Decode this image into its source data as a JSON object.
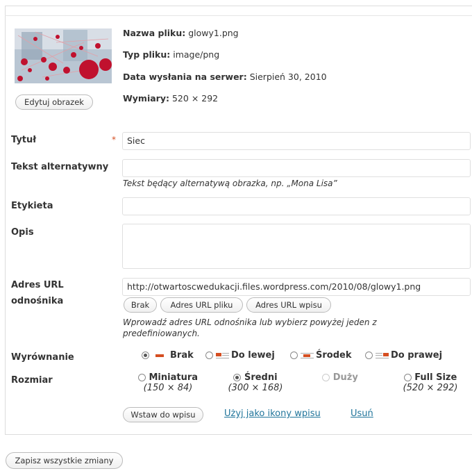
{
  "file": {
    "name_label": "Nazwa pliku:",
    "name": "glowy1.png",
    "type_label": "Typ pliku:",
    "type": "image/png",
    "date_label": "Data wysłania na serwer:",
    "date": "Sierpień 30, 2010",
    "dims_label": "Wymiary:",
    "dims": "520 × 292"
  },
  "edit_image_label": "Edytuj obrazek",
  "fields": {
    "title_label": "Tytuł",
    "title_required": "*",
    "title_value": "Siec",
    "alt_label": "Tekst alternatywny",
    "alt_value": "",
    "alt_hint": "Tekst będący alternatywą obrazka, np. „Mona Lisa”",
    "caption_label": "Etykieta",
    "caption_value": "",
    "desc_label": "Opis",
    "desc_value": "",
    "url_label_1": "Adres URL",
    "url_label_2": "odnośnika",
    "url_value": "http://otwartoscwedukacji.files.wordpress.com/2010/08/glowy1.png",
    "url_buttons": [
      "Brak",
      "Adres URL pliku",
      "Adres URL wpisu"
    ],
    "url_hint_1": "Wprowadź adres URL odnośnika lub wybierz powyżej jeden z",
    "url_hint_2": "predefiniowanych."
  },
  "alignment": {
    "label": "Wyrównanie",
    "options": [
      "Brak",
      "Do lewej",
      "Środek",
      "Do prawej"
    ],
    "selected": "Brak"
  },
  "size": {
    "label": "Rozmiar",
    "options": [
      {
        "name": "Miniatura",
        "dims": "(150 × 84)"
      },
      {
        "name": "Średni",
        "dims": "(300 × 168)"
      },
      {
        "name": "Duży",
        "dims": ""
      },
      {
        "name": "Full Size",
        "dims": "(520 × 292)"
      }
    ],
    "selected": "Średni"
  },
  "actions": {
    "insert": "Wstaw do wpisu",
    "use_as_icon": "Użyj jako ikony wpisu",
    "delete": "Usuń"
  },
  "save_all": "Zapisz wszystkie zmiany",
  "colors": {
    "link": "#21759b",
    "required": "#d54e21",
    "accent": "#d54e21"
  }
}
